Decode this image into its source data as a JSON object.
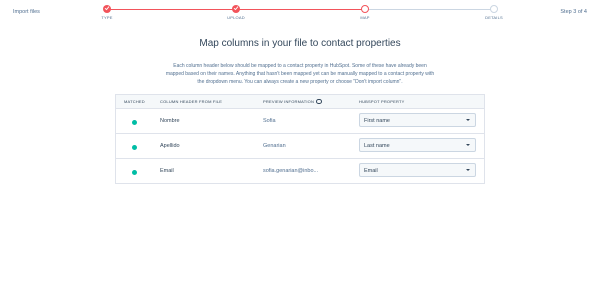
{
  "header": {
    "import_link": "Import files",
    "step_counter": "Step 3 of 4"
  },
  "stepper": {
    "steps": [
      {
        "label": "TYPE",
        "state": "done"
      },
      {
        "label": "UPLOAD",
        "state": "done"
      },
      {
        "label": "MAP",
        "state": "current"
      },
      {
        "label": "DETAILS",
        "state": "todo"
      }
    ]
  },
  "main": {
    "title": "Map columns in your file to contact properties",
    "description": "Each column header below should be mapped to a contact property in HubSpot. Some of these have already been mapped based on their names. Anything that hasn't been mapped yet can be manually mapped to a contact property with the dropdown menu. You can always create a new property or choose \"Don't import column\"."
  },
  "table": {
    "headers": {
      "matched": "MATCHED",
      "column_header": "COLUMN HEADER FROM FILE",
      "preview": "PREVIEW INFORMATION",
      "property": "HUBSPOT PROPERTY"
    },
    "rows": [
      {
        "column": "Nombre",
        "preview": "Sofia",
        "property": "First name"
      },
      {
        "column": "Apellido",
        "preview": "Genarian",
        "property": "Last name"
      },
      {
        "column": "Email",
        "preview": "sofia.genarian@inbo...",
        "property": "Email"
      }
    ]
  },
  "colors": {
    "accent": "#f2545b",
    "matched": "#00bda5",
    "border": "#dfe3eb"
  }
}
